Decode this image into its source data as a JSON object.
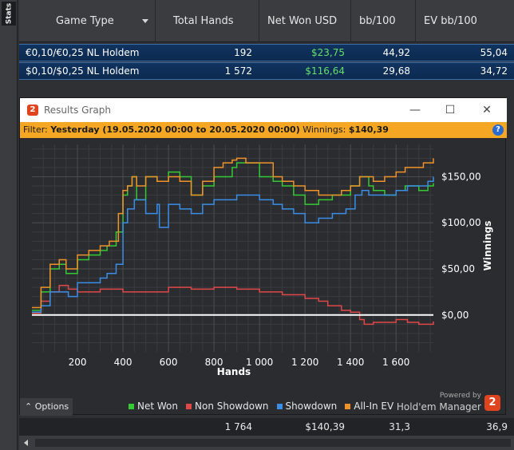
{
  "sidebar": {
    "tab_label": "Stats"
  },
  "table": {
    "columns": [
      "Game Type",
      "Total Hands",
      "Net Won USD",
      "bb/100",
      "EV bb/100"
    ],
    "rows": [
      {
        "game": "€0,10/€0,25 NL Holdem",
        "hands": "192",
        "net": "$23,75",
        "bb": "44,92",
        "ev": "55,04"
      },
      {
        "game": "$0,10/$0,25 NL Holdem",
        "hands": "1 572",
        "net": "$116,64",
        "bb": "29,68",
        "ev": "34,72"
      }
    ],
    "totals": {
      "hands": "1 764",
      "net": "$140,39",
      "bb": "31,3",
      "ev": "36,9"
    }
  },
  "window": {
    "title": "Results Graph",
    "logo_text": "2",
    "filter_prefix": "Filter:",
    "filter_value": "Yesterday (19.05.2020 00:00 to 20.05.2020 00:00)",
    "winnings_label": "Winnings:",
    "winnings_value": "$140,39",
    "help_label": "?",
    "minimize_glyph": "—",
    "maximize_glyph": "☐",
    "close_glyph": "✕"
  },
  "options_label": "Options",
  "brand": {
    "powered_by": "Powered by",
    "name": "Hold'em Manager",
    "logo_text": "2"
  },
  "chart_data": {
    "type": "line",
    "xlabel": "Hands",
    "ylabel": "Winnings",
    "xlim": [
      0,
      1764
    ],
    "ylim": [
      -40,
      185
    ],
    "x_ticks": [
      200,
      400,
      600,
      800,
      1000,
      1200,
      1400,
      1600
    ],
    "x_tick_labels": [
      "200",
      "400",
      "600",
      "800",
      "1 000",
      "1 200",
      "1 400",
      "1 600"
    ],
    "y_ticks": [
      0,
      50,
      100,
      150
    ],
    "y_tick_labels": [
      "$0,00",
      "$50,00",
      "$100,00",
      "$150,00"
    ],
    "grid": true,
    "legend_position": "bottom",
    "series": [
      {
        "name": "Net Won",
        "color": "#35c935",
        "x": [
          0,
          40,
          80,
          120,
          150,
          200,
          250,
          300,
          330,
          370,
          400,
          420,
          440,
          460,
          500,
          550,
          600,
          650,
          700,
          750,
          800,
          840,
          880,
          900,
          940,
          1000,
          1060,
          1100,
          1150,
          1200,
          1260,
          1320,
          1400,
          1440,
          1480,
          1500,
          1550,
          1600,
          1640,
          1700,
          1740,
          1764
        ],
        "y": [
          5,
          25,
          50,
          55,
          45,
          60,
          65,
          70,
          75,
          90,
          130,
          140,
          150,
          125,
          150,
          145,
          155,
          150,
          130,
          140,
          150,
          150,
          160,
          165,
          165,
          150,
          145,
          140,
          130,
          120,
          125,
          130,
          140,
          150,
          140,
          135,
          130,
          135,
          140,
          135,
          140,
          143
        ]
      },
      {
        "name": "Non Showdown",
        "color": "#e04848",
        "x": [
          0,
          40,
          80,
          120,
          160,
          200,
          300,
          400,
          500,
          600,
          700,
          800,
          900,
          1000,
          1100,
          1200,
          1260,
          1300,
          1360,
          1400,
          1440,
          1460,
          1500,
          1560,
          1600,
          1650,
          1700,
          1764
        ],
        "y": [
          2,
          15,
          25,
          32,
          28,
          25,
          28,
          25,
          25,
          30,
          28,
          30,
          28,
          25,
          22,
          18,
          15,
          10,
          5,
          3,
          -5,
          -10,
          -8,
          -8,
          -5,
          -8,
          -10,
          -7
        ]
      },
      {
        "name": "Showdown",
        "color": "#3a8ee6",
        "x": [
          0,
          40,
          80,
          120,
          160,
          200,
          300,
          330,
          370,
          400,
          420,
          450,
          500,
          550,
          560,
          600,
          650,
          700,
          750,
          800,
          850,
          880,
          900,
          960,
          1000,
          1060,
          1100,
          1150,
          1200,
          1260,
          1320,
          1380,
          1420,
          1450,
          1480,
          1500,
          1560,
          1600,
          1650,
          1700,
          1740,
          1764
        ],
        "y": [
          3,
          10,
          25,
          25,
          20,
          35,
          40,
          45,
          55,
          100,
          115,
          125,
          110,
          120,
          95,
          120,
          115,
          110,
          120,
          125,
          125,
          125,
          130,
          130,
          125,
          120,
          115,
          110,
          100,
          105,
          110,
          115,
          130,
          135,
          130,
          130,
          130,
          135,
          140,
          140,
          145,
          150
        ]
      },
      {
        "name": "All-In EV",
        "color": "#f0922a",
        "x": [
          0,
          40,
          80,
          120,
          150,
          200,
          250,
          300,
          340,
          380,
          400,
          420,
          440,
          460,
          500,
          550,
          600,
          650,
          700,
          750,
          800,
          840,
          880,
          900,
          940,
          1000,
          1060,
          1100,
          1150,
          1200,
          1260,
          1320,
          1360,
          1400,
          1440,
          1480,
          1500,
          1550,
          1600,
          1640,
          1680,
          1720,
          1764
        ],
        "y": [
          8,
          30,
          55,
          60,
          50,
          65,
          70,
          75,
          80,
          110,
          135,
          140,
          150,
          140,
          150,
          145,
          150,
          145,
          130,
          145,
          160,
          165,
          168,
          170,
          165,
          165,
          150,
          145,
          140,
          135,
          130,
          130,
          135,
          140,
          150,
          150,
          145,
          150,
          155,
          160,
          160,
          165,
          170
        ]
      }
    ]
  }
}
